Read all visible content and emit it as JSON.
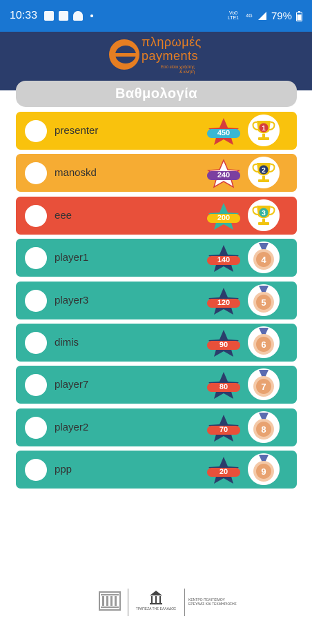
{
  "status_bar": {
    "time": "10:33",
    "network_top": "Vo0 LTE1",
    "network_gen": "4G",
    "battery": "79%"
  },
  "header": {
    "logo_text_top": "πληρωμές",
    "logo_text_bottom": "payments",
    "logo_tagline_1": "Εσύ είσαι χρήστης",
    "logo_tagline_2": "& κινητή"
  },
  "title": "Βαθμολογία",
  "leaderboard": [
    {
      "rank": "1",
      "name": "presenter",
      "score": "450",
      "row_color": "#f9c20d",
      "star_color": "#d63c3c",
      "pill_color": "#3ab7d3",
      "medal_type": "trophy",
      "medal_color": "#d63c3c"
    },
    {
      "rank": "2",
      "name": "manoskd",
      "score": "240",
      "row_color": "#f6ac33",
      "star_color": "#ffffff",
      "pill_color": "#7b3fa0",
      "medal_type": "trophy",
      "medal_color": "#2b3d6b"
    },
    {
      "rank": "3",
      "name": "eee",
      "score": "200",
      "row_color": "#e8503a",
      "star_color": "#35b3a0",
      "pill_color": "#f9c20d",
      "medal_type": "trophy",
      "medal_color": "#35b3a0"
    },
    {
      "rank": "4",
      "name": "player1",
      "score": "140",
      "row_color": "#35b3a0",
      "star_color": "#2b3d6b",
      "pill_color": "#e8503a",
      "medal_type": "medal",
      "medal_color": "#e8a270"
    },
    {
      "rank": "5",
      "name": "player3",
      "score": "120",
      "row_color": "#35b3a0",
      "star_color": "#2b3d6b",
      "pill_color": "#e8503a",
      "medal_type": "medal",
      "medal_color": "#e8a270"
    },
    {
      "rank": "6",
      "name": "dimis",
      "score": "90",
      "row_color": "#35b3a0",
      "star_color": "#2b3d6b",
      "pill_color": "#e8503a",
      "medal_type": "medal",
      "medal_color": "#e8a270"
    },
    {
      "rank": "7",
      "name": "player7",
      "score": "80",
      "row_color": "#35b3a0",
      "star_color": "#2b3d6b",
      "pill_color": "#e8503a",
      "medal_type": "medal",
      "medal_color": "#e8a270"
    },
    {
      "rank": "8",
      "name": "player2",
      "score": "70",
      "row_color": "#35b3a0",
      "star_color": "#2b3d6b",
      "pill_color": "#e8503a",
      "medal_type": "medal",
      "medal_color": "#e8a270"
    },
    {
      "rank": "9",
      "name": "ppp",
      "score": "20",
      "row_color": "#35b3a0",
      "star_color": "#2b3d6b",
      "pill_color": "#e8503a",
      "medal_type": "medal",
      "medal_color": "#e8a270"
    }
  ],
  "footer": {
    "bank_name": "ΤΡΑΠΕΖΑ ΤΗΣ ΕΛΛΑΔΟΣ",
    "center_name_1": "ΚΕΝΤΡΟ ΠΟΛΙΤΙΣΜΟΥ",
    "center_name_2": "ΕΡΕΥΝΑΣ ΚΑΙ ΤΕΚΜΗΡΙΩΣΗΣ"
  },
  "colors": {
    "status_bar": "#1976d2",
    "header": "#2b3d6b",
    "accent_orange": "#e67e22",
    "title_bar": "#cfcfcf"
  }
}
